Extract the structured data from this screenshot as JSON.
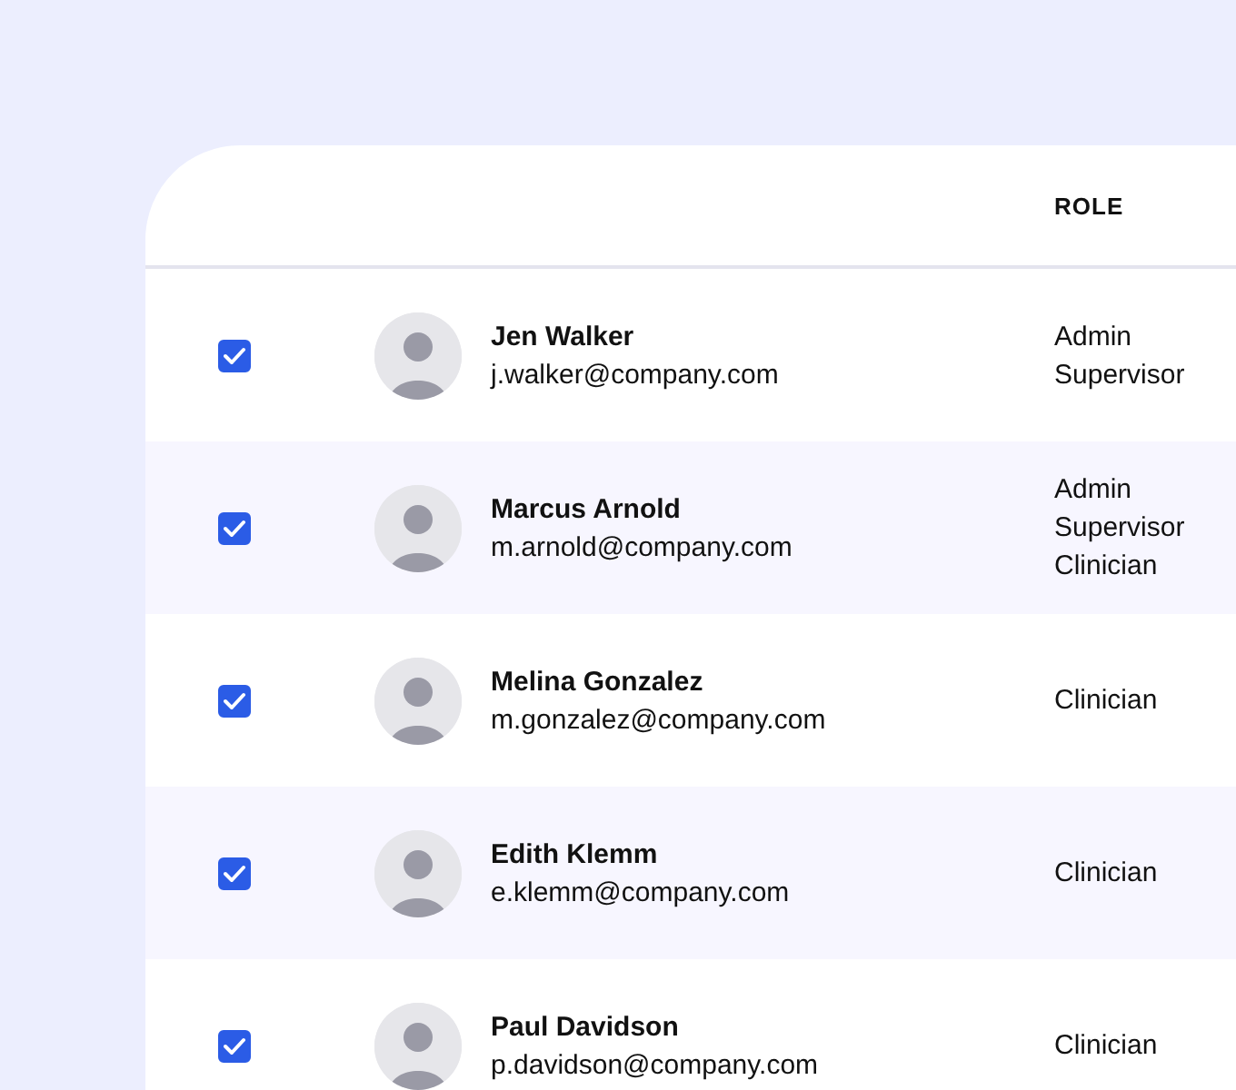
{
  "table": {
    "columns": [
      {
        "label": "ROLE"
      }
    ],
    "rows": [
      {
        "checked": true,
        "name": "Jen Walker",
        "email": "j.walker@company.com",
        "roles": [
          "Admin",
          "Supervisor"
        ]
      },
      {
        "checked": true,
        "name": "Marcus Arnold",
        "email": "m.arnold@company.com",
        "roles": [
          "Admin",
          "Supervisor",
          "Clinician"
        ]
      },
      {
        "checked": true,
        "name": "Melina Gonzalez",
        "email": "m.gonzalez@company.com",
        "roles": [
          "Clinician"
        ]
      },
      {
        "checked": true,
        "name": "Edith Klemm",
        "email": "e.klemm@company.com",
        "roles": [
          "Clinician"
        ]
      },
      {
        "checked": true,
        "name": "Paul Davidson",
        "email": "p.davidson@company.com",
        "roles": [
          "Clinician"
        ]
      }
    ]
  }
}
